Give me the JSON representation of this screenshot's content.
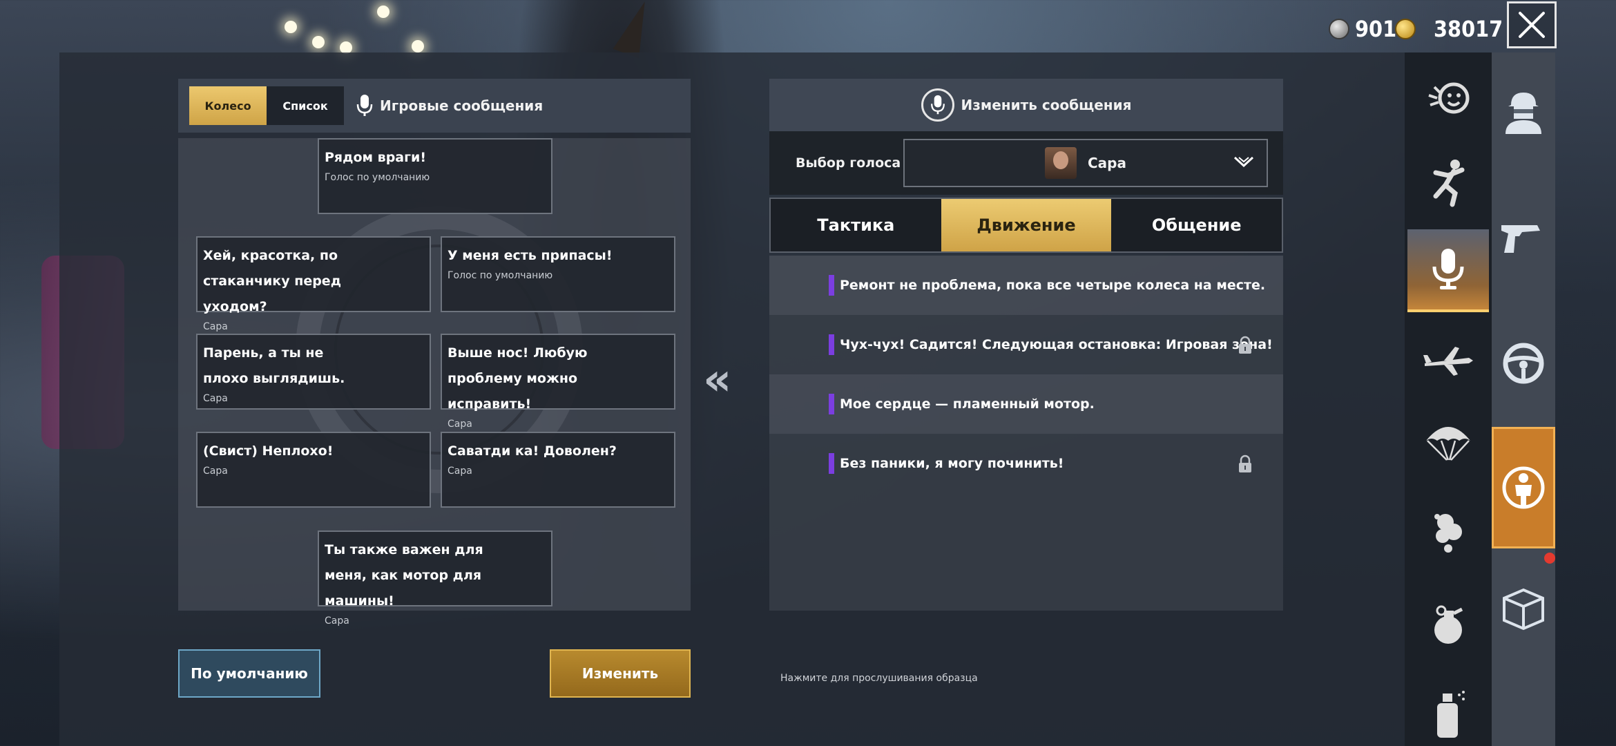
{
  "currency": {
    "silver_value": "901",
    "gold_value": "38017",
    "silver_icon": "silver-coin-icon",
    "gold_icon": "gold-coin-icon"
  },
  "close_icon": "close-icon",
  "left_panel": {
    "mode_wheel": "Колесо",
    "mode_list": "Список",
    "title": "Игровые сообщения",
    "messages": [
      {
        "text": "Рядом враги!",
        "sub": "Голос по умолчанию"
      },
      {
        "text": "Хей, красотка, по стаканчику перед уходом?",
        "sub": "Сара"
      },
      {
        "text": "У меня есть припасы!",
        "sub": "Голос по умолчанию"
      },
      {
        "text": "Парень, а ты не плохо выглядишь.",
        "sub": "Сара"
      },
      {
        "text": "Выше нос! Любую проблему можно исправить!",
        "sub": "Сара"
      },
      {
        "text": "(Свист) Неплохо!",
        "sub": "Сара"
      },
      {
        "text": "Саватди ка! Доволен?",
        "sub": "Сара"
      },
      {
        "text": "Ты также важен для меня, как мотор для машины!",
        "sub": "Сара"
      }
    ],
    "btn_default": "По умолчанию",
    "btn_edit": "Изменить"
  },
  "transfer_label": "«",
  "right_panel": {
    "header": "Изменить сообщения",
    "voice_label": "Выбор голоса",
    "voice_value": "Сара",
    "tabs": [
      "Тактика",
      "Движение",
      "Общение"
    ],
    "active_tab": "Движение",
    "items": [
      {
        "text": "Ремонт не проблема, пока все четыре колеса на месте.",
        "locked": false
      },
      {
        "text": "Чух-чух! Садится! Следующая остановка: Игровая зона!",
        "locked": true
      },
      {
        "text": "Мое сердце — пламенный мотор.",
        "locked": false
      },
      {
        "text": "Без паники, я могу починить!",
        "locked": true
      }
    ],
    "hint": "Нажмите для прослушивания образца"
  },
  "colors": {
    "accent_gold": "#cfa447",
    "accent_purple": "#7b3ee0",
    "accent_orange": "#c97d2a"
  },
  "sidebar_icons": [
    "emote-icon",
    "dance-icon",
    "microphone-icon",
    "plane-icon",
    "parachute-icon",
    "smoke-icon",
    "grenade-icon",
    "spray-icon"
  ],
  "sidebar2_icons": [
    "character-icon",
    "pistol-icon",
    "steering-wheel-icon",
    "player-marker-icon",
    "crate-icon"
  ]
}
